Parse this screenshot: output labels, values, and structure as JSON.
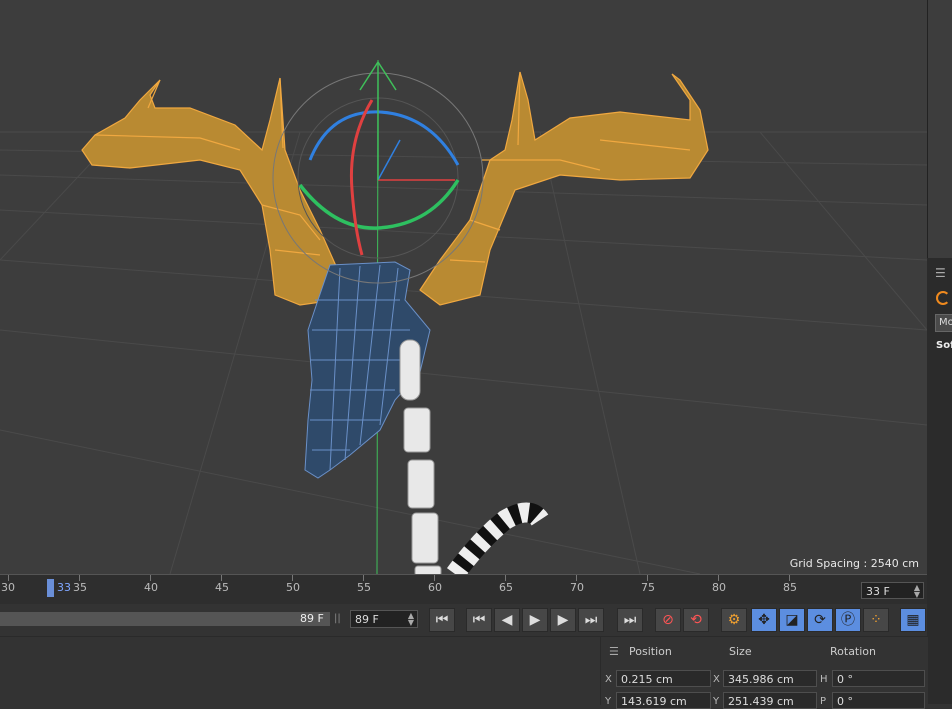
{
  "viewport": {
    "grid_spacing": "Grid Spacing : 2540 cm",
    "colors": {
      "antlers": "#e8a33a",
      "skull": "#5d7fae",
      "axis_x": "#e04040",
      "axis_y": "#40c060",
      "axis_z": "#3a80e0"
    }
  },
  "right_panel": {
    "handle": "☰",
    "mode_tab": "Mo",
    "label": "Sof"
  },
  "timeline": {
    "ticks": [
      {
        "label": "30"
      },
      {
        "label": "35"
      },
      {
        "label": "40"
      },
      {
        "label": "45"
      },
      {
        "label": "50"
      },
      {
        "label": "55"
      },
      {
        "label": "60"
      },
      {
        "label": "65"
      },
      {
        "label": "70"
      },
      {
        "label": "75"
      },
      {
        "label": "80"
      },
      {
        "label": "85"
      }
    ],
    "playhead": "33",
    "current_frame": "33 F"
  },
  "transport": {
    "range_end": "89 F",
    "range_grip": "||",
    "max_frame": "89 F",
    "buttons": {
      "goto_start": "⏮",
      "prev_key": "⏮",
      "prev_frame": "◀",
      "play": "▶",
      "next_frame": "▶",
      "next_key": "⏭",
      "goto_end": "⏭",
      "record": "⊘",
      "autokey": "⟲",
      "keyframe_settings": "⚙",
      "move": "✥",
      "scale": "◪",
      "rotate": "⟳",
      "param": "Ⓟ",
      "pla": "⁘",
      "timeline": "▦"
    }
  },
  "coords": {
    "handle": "☰",
    "headers": {
      "position": "Position",
      "size": "Size",
      "rotation": "Rotation"
    },
    "rows": [
      {
        "axis": "X",
        "position": "0.215 cm",
        "size_axis": "X",
        "size": "345.986 cm",
        "rot_axis": "H",
        "rotation": "0 °"
      },
      {
        "axis": "Y",
        "position": "143.619 cm",
        "size_axis": "Y",
        "size": "251.439 cm",
        "rot_axis": "P",
        "rotation": "0 °"
      }
    ]
  }
}
